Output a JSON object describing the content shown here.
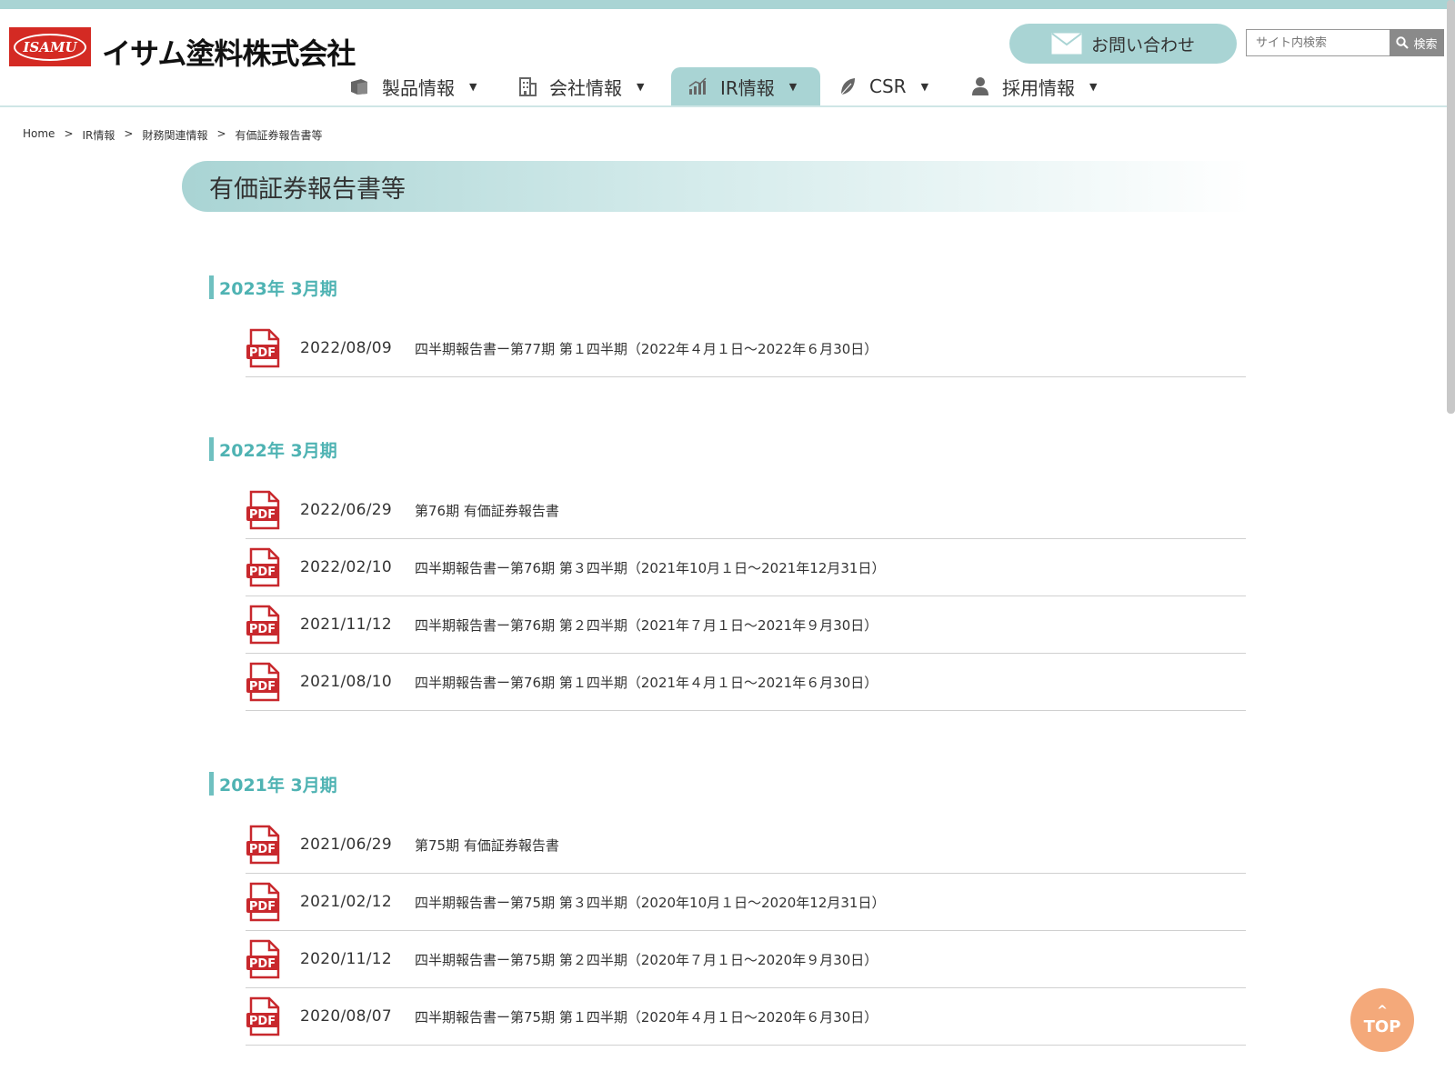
{
  "header": {
    "logo_badge": "ISAMU",
    "logo_text": "イサム塗料株式会社",
    "contact_label": "お問い合わせ",
    "search_placeholder": "サイト内検索",
    "search_button": "検索"
  },
  "nav": {
    "items": [
      {
        "label": "製品情報",
        "icon": "box-icon"
      },
      {
        "label": "会社情報",
        "icon": "building-icon"
      },
      {
        "label": "IR情報",
        "icon": "chart-icon",
        "active": true
      },
      {
        "label": "CSR",
        "icon": "leaf-icon"
      },
      {
        "label": "採用情報",
        "icon": "person-icon"
      }
    ]
  },
  "breadcrumb": {
    "items": [
      "Home",
      "IR情報",
      "財務関連情報",
      "有価証券報告書等"
    ],
    "separator": ">"
  },
  "page_title": "有価証券報告書等",
  "sections": [
    {
      "heading": "2023年 3月期",
      "documents": [
        {
          "date": "2022/08/09",
          "title": "四半期報告書ー第77期 第１四半期（2022年４月１日〜2022年６月30日）"
        }
      ]
    },
    {
      "heading": "2022年 3月期",
      "documents": [
        {
          "date": "2022/06/29",
          "title": "第76期 有価証券報告書"
        },
        {
          "date": "2022/02/10",
          "title": "四半期報告書ー第76期 第３四半期（2021年10月１日〜2021年12月31日）"
        },
        {
          "date": "2021/11/12",
          "title": "四半期報告書ー第76期 第２四半期（2021年７月１日〜2021年９月30日）"
        },
        {
          "date": "2021/08/10",
          "title": "四半期報告書ー第76期 第１四半期（2021年４月１日〜2021年６月30日）"
        }
      ]
    },
    {
      "heading": "2021年 3月期",
      "documents": [
        {
          "date": "2021/06/29",
          "title": "第75期 有価証券報告書"
        },
        {
          "date": "2021/02/12",
          "title": "四半期報告書ー第75期 第３四半期（2020年10月１日〜2020年12月31日）"
        },
        {
          "date": "2020/11/12",
          "title": "四半期報告書ー第75期 第２四半期（2020年７月１日〜2020年９月30日）"
        },
        {
          "date": "2020/08/07",
          "title": "四半期報告書ー第75期 第１四半期（2020年４月１日〜2020年６月30日）"
        }
      ]
    }
  ],
  "pdf_label": "PDF",
  "top_button": "TOP",
  "colors": {
    "accent": "#a9d4d4",
    "heading": "#4fb3b3",
    "pdf_red": "#c8282d",
    "logo_red": "#d42a23",
    "top_button": "#f4a97a"
  }
}
